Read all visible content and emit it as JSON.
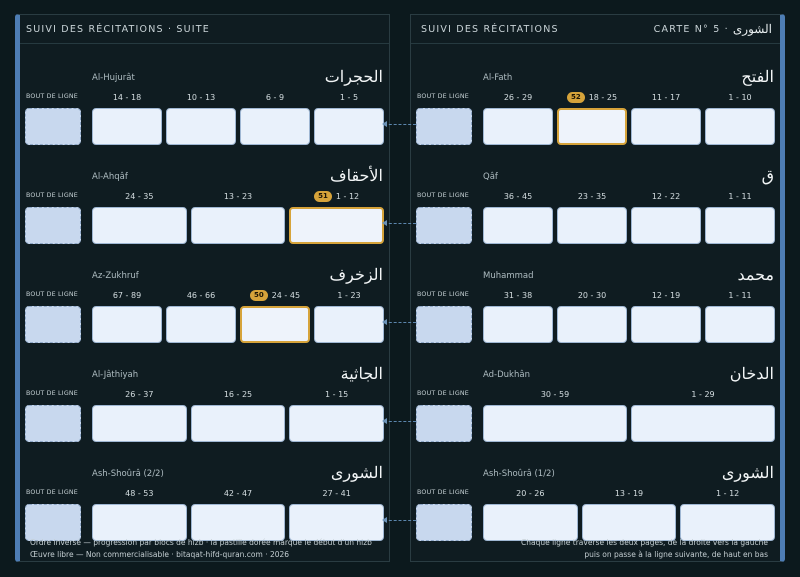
{
  "left_page": {
    "header_title": "SUIVI DES RÉCITATIONS · SUITE",
    "bout_label": "BOUT DE LIGNE",
    "rows": [
      {
        "translit": "Al-Hujurât",
        "arabic": "الحجرات",
        "blocks": [
          {
            "label": "14 - 18"
          },
          {
            "label": "10 - 13"
          },
          {
            "label": "6 - 9"
          },
          {
            "label": "1 - 5"
          }
        ]
      },
      {
        "translit": "Al-Ahqâf",
        "arabic": "الأحقاف",
        "blocks": [
          {
            "label": "24 - 35"
          },
          {
            "label": "13 - 23"
          },
          {
            "label": "1 - 12",
            "badge": "51"
          }
        ]
      },
      {
        "translit": "Az-Zukhruf",
        "arabic": "الزخرف",
        "blocks": [
          {
            "label": "67 - 89"
          },
          {
            "label": "46 - 66"
          },
          {
            "label": "24 - 45",
            "badge": "50"
          },
          {
            "label": "1 - 23"
          }
        ]
      },
      {
        "translit": "Al-Jâthiyah",
        "arabic": "الجاثية",
        "blocks": [
          {
            "label": "26 - 37"
          },
          {
            "label": "16 - 25"
          },
          {
            "label": "1 - 15"
          }
        ]
      },
      {
        "translit": "Ash-Shoûrâ (2/2)",
        "arabic": "الشورى",
        "blocks": [
          {
            "label": "48 - 53"
          },
          {
            "label": "42 - 47"
          },
          {
            "label": "27 - 41"
          }
        ]
      }
    ],
    "footer_line1": "Ordre inversé — progression par blocs de hizb · la pastille dorée marque le début d'un hizb",
    "footer_line2": "Œuvre libre — Non commercialisable · bitaqat-hifd-quran.com · 2026"
  },
  "right_page": {
    "header_title": "SUIVI DES RÉCITATIONS",
    "card_label": "CARTE N° 5 ·",
    "card_arabic": "الشورى",
    "bout_label": "BOUT DE LIGNE",
    "rows": [
      {
        "translit": "Al-Fath",
        "arabic": "الفتح",
        "blocks": [
          {
            "label": "26 - 29"
          },
          {
            "label": "18 - 25",
            "badge": "52"
          },
          {
            "label": "11 - 17"
          },
          {
            "label": "1 - 10"
          }
        ]
      },
      {
        "translit": "Qâf",
        "arabic": "ق",
        "blocks": [
          {
            "label": "36 - 45"
          },
          {
            "label": "23 - 35"
          },
          {
            "label": "12 - 22"
          },
          {
            "label": "1 - 11"
          }
        ]
      },
      {
        "translit": "Muhammad",
        "arabic": "محمد",
        "blocks": [
          {
            "label": "31 - 38"
          },
          {
            "label": "20 - 30"
          },
          {
            "label": "12 - 19"
          },
          {
            "label": "1 - 11"
          }
        ]
      },
      {
        "translit": "Ad-Dukhân",
        "arabic": "الدخان",
        "blocks": [
          {
            "label": "30 - 59"
          },
          {
            "label": "1 - 29"
          }
        ]
      },
      {
        "translit": "Ash-Shoûrâ (1/2)",
        "arabic": "الشورى",
        "blocks": [
          {
            "label": "20 - 26"
          },
          {
            "label": "13 - 19"
          },
          {
            "label": "1 - 12"
          }
        ]
      }
    ],
    "footer_line1": "Chaque ligne traverse les deux pages, de la droite vers la gauche",
    "footer_line2": "puis on passe à la ligne suivante, de haut en bas"
  },
  "colors": {
    "background": "#0c191d",
    "accent_blue": "#4e7db4",
    "hizb_gold": "#d6a33a",
    "box_fill": "#e9f1fb",
    "bout_fill": "#c8d8ee"
  }
}
